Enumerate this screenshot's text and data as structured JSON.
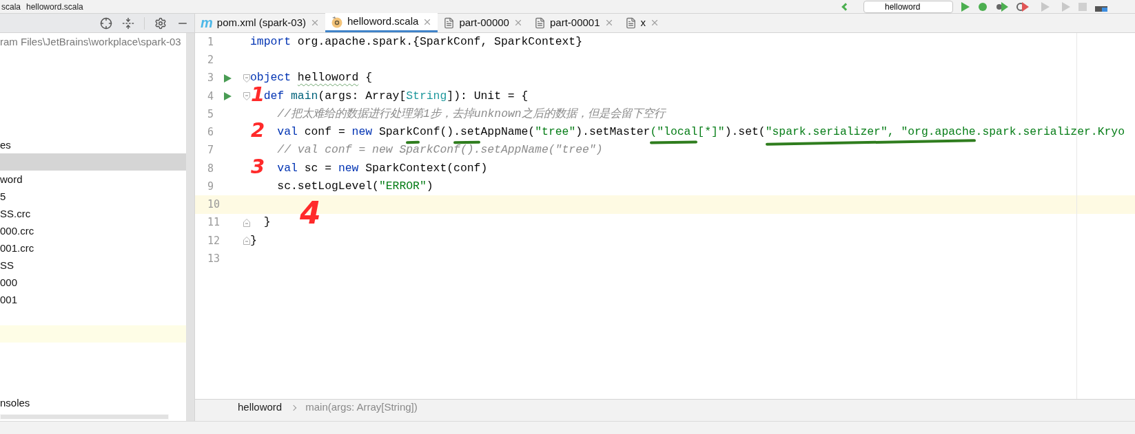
{
  "top_bar": {
    "breadcrumb": [
      "scala",
      "helloword.scala"
    ],
    "run_config": "helloword"
  },
  "project_panel": {
    "path": "ram Files\\JetBrains\\workplace\\spark-03",
    "rows": [
      {
        "selected": false,
        "current": false
      },
      {
        "selected": false,
        "current": false
      },
      {
        "selected": false,
        "current": false
      },
      {
        "selected": false,
        "current": false
      },
      {
        "selected": false,
        "current": false
      },
      {
        "text": "es",
        "selected": false,
        "current": false
      },
      {
        "selected": true,
        "current": false
      },
      {
        "text": "word",
        "selected": false,
        "current": false
      },
      {
        "text": "5",
        "selected": false,
        "current": false
      },
      {
        "text": "SS.crc",
        "selected": false,
        "current": false
      },
      {
        "text": "000.crc",
        "selected": false,
        "current": false
      },
      {
        "text": "001.crc",
        "selected": false,
        "current": false
      },
      {
        "text": "SS",
        "selected": false,
        "current": false
      },
      {
        "text": "000",
        "selected": false,
        "current": false
      },
      {
        "text": "001",
        "selected": false,
        "current": false
      },
      {
        "selected": false,
        "current": false
      },
      {
        "selected": false,
        "current": true
      },
      {
        "selected": false,
        "current": false
      },
      {
        "selected": false,
        "current": false
      },
      {
        "selected": false,
        "current": false
      },
      {
        "text": "nsoles",
        "selected": false,
        "current": false
      }
    ]
  },
  "tabs": [
    {
      "label": "pom.xml (spark-03)",
      "kind": "maven",
      "glyph": "m",
      "selected": false
    },
    {
      "label": "helloword.scala",
      "kind": "scala",
      "selected": true
    },
    {
      "label": "part-00000",
      "kind": "file",
      "selected": false
    },
    {
      "label": "part-00001",
      "kind": "file",
      "selected": false
    },
    {
      "label": "x",
      "kind": "file",
      "selected": false
    }
  ],
  "editor": {
    "lines": [
      {
        "number": "1",
        "run": false,
        "current": false,
        "fold_open": false,
        "fold_close": false,
        "tokens": [
          {
            "text": "import",
            "kind": "keyword"
          },
          {
            "text": " org.apache.spark.{SparkConf, SparkContext}",
            "kind": "plain"
          }
        ]
      },
      {
        "number": "2",
        "run": false,
        "current": false,
        "fold_open": false,
        "fold_close": false
      },
      {
        "number": "3",
        "run": true,
        "current": false,
        "fold_open": true,
        "fold_close": false,
        "tokens": [
          {
            "text": "object ",
            "kind": "keyword",
            "typo": false
          },
          {
            "text": "helloword",
            "kind": "plain",
            "typo": true
          },
          {
            "text": " {",
            "kind": "plain",
            "typo": false
          }
        ]
      },
      {
        "number": "4",
        "run": true,
        "current": false,
        "fold_open": true,
        "fold_close": false,
        "annotation": {
          "text": "1",
          "kind": "margin"
        },
        "tokens": [
          {
            "text": "  def ",
            "kind": "keyword"
          },
          {
            "text": "main",
            "kind": "function"
          },
          {
            "text": "(args: Array[",
            "kind": "plain"
          },
          {
            "text": "String",
            "kind": "type"
          },
          {
            "text": "]): Unit = {",
            "kind": "plain"
          }
        ]
      },
      {
        "number": "5",
        "run": false,
        "current": false,
        "fold_open": false,
        "fold_close": false,
        "tokens": [
          {
            "text": "    //把太难给的数据进行处理第1步，去掉unknown之后的数据，但是会留下空行",
            "kind": "comment"
          }
        ]
      },
      {
        "number": "6",
        "run": false,
        "current": false,
        "fold_open": false,
        "fold_close": false,
        "annotation": {
          "text": "2",
          "kind": "margin"
        },
        "tokens": [
          {
            "text": "    val",
            "kind": "keyword",
            "underlined": false
          },
          {
            "text": " conf = ",
            "kind": "plain",
            "underlined": false
          },
          {
            "text": "new",
            "kind": "keyword",
            "underlined": false
          },
          {
            "text": " Spar",
            "kind": "plain",
            "underlined": false
          },
          {
            "text": "kC",
            "kind": "plain",
            "underlined": true
          },
          {
            "text": "onf()",
            "kind": "plain",
            "underlined": false
          },
          {
            "text": ".set",
            "kind": "plain",
            "underlined": true
          },
          {
            "text": "AppName(",
            "kind": "plain",
            "underlined": false
          },
          {
            "text": "\"tree\"",
            "kind": "string",
            "underlined": false
          },
          {
            "text": ").setMaster",
            "kind": "plain",
            "underlined": false
          },
          {
            "text": "(\"local",
            "kind": "string",
            "underlined": true
          },
          {
            "text": "[*]\"",
            "kind": "string",
            "underlined": false
          },
          {
            "text": ").set(",
            "kind": "plain",
            "underlined": false
          },
          {
            "text": "\"spark.serializer\", \"org.apache",
            "kind": "string",
            "underlined": true
          },
          {
            "text": ".spark.serializer.Kryo",
            "kind": "string",
            "underlined": false
          }
        ]
      },
      {
        "number": "7",
        "run": false,
        "current": false,
        "fold_open": false,
        "fold_close": false,
        "tokens": [
          {
            "text": "    // val conf = new SparkConf().setAppName(\"tree\")",
            "kind": "comment"
          }
        ]
      },
      {
        "number": "8",
        "run": false,
        "current": false,
        "fold_open": false,
        "fold_close": false,
        "annotation": {
          "text": "3",
          "kind": "margin"
        },
        "tokens": [
          {
            "text": "    val",
            "kind": "keyword"
          },
          {
            "text": " sc = ",
            "kind": "plain"
          },
          {
            "text": "new",
            "kind": "keyword"
          },
          {
            "text": " SparkContext(conf)",
            "kind": "plain"
          }
        ]
      },
      {
        "number": "9",
        "run": false,
        "current": false,
        "fold_open": false,
        "fold_close": false,
        "tokens": [
          {
            "text": "    sc.setLogLevel(",
            "kind": "plain"
          },
          {
            "text": "\"ERROR\"",
            "kind": "string"
          },
          {
            "text": ")",
            "kind": "plain"
          }
        ]
      },
      {
        "number": "10",
        "run": false,
        "current": true,
        "fold_open": false,
        "fold_close": false,
        "annotation": {
          "text": "4",
          "kind": "below"
        }
      },
      {
        "number": "11",
        "run": false,
        "current": false,
        "fold_open": false,
        "fold_close": true,
        "tokens": [
          {
            "text": "  }",
            "kind": "plain"
          }
        ]
      },
      {
        "number": "12",
        "run": false,
        "current": false,
        "fold_open": false,
        "fold_close": true,
        "tokens": [
          {
            "text": "}",
            "kind": "plain"
          }
        ]
      },
      {
        "number": "13",
        "run": false,
        "current": false,
        "fold_open": false,
        "fold_close": false
      }
    ]
  },
  "breadcrumb": [
    "helloword",
    "main(args: Array[String])"
  ]
}
